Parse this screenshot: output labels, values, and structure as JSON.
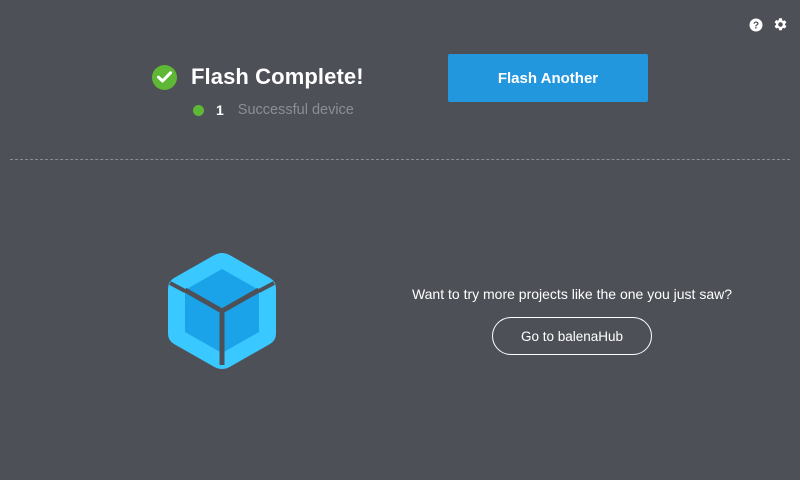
{
  "header": {
    "icons": {
      "help": "help-icon",
      "settings": "gear-icon"
    }
  },
  "status": {
    "title": "Flash Complete!",
    "device_count": "1",
    "device_label": "Successful device",
    "success_color": "#5fb835"
  },
  "actions": {
    "flash_another_label": "Flash Another",
    "accent_color": "#2297de"
  },
  "promo": {
    "text": "Want to try more projects like the one you just saw?",
    "button_label": "Go to balenaHub",
    "logo": "balena-cube-icon"
  }
}
